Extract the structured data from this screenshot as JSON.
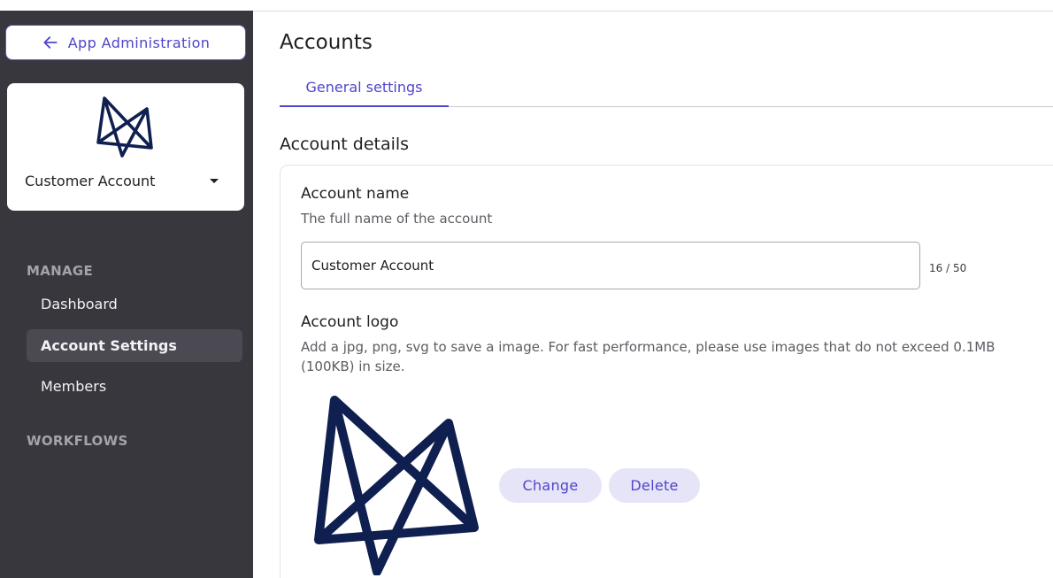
{
  "sidebar": {
    "back_label": "App Administration",
    "account": {
      "name": "Customer Account"
    },
    "sections": [
      {
        "label": "MANAGE",
        "items": [
          {
            "label": "Dashboard",
            "active": false
          },
          {
            "label": "Account Settings",
            "active": true
          },
          {
            "label": "Members",
            "active": false
          }
        ]
      },
      {
        "label": "WORKFLOWS",
        "items": []
      }
    ]
  },
  "main": {
    "title": "Accounts",
    "tabs": [
      {
        "label": "General settings",
        "active": true
      }
    ],
    "section_title": "Account details",
    "account_name": {
      "label": "Account name",
      "help": "The full name of the account",
      "value": "Customer Account",
      "counter": "16 / 50"
    },
    "account_logo": {
      "label": "Account logo",
      "help": "Add a jpg, png, svg to save a image. For fast performance, please use images that do not exceed 0.1MB (100KB) in size.",
      "change_label": "Change",
      "delete_label": "Delete"
    }
  },
  "colors": {
    "accent": "#4f46c9",
    "sidebar_bg": "#38373d",
    "logo": "#0f1f4f",
    "pill_bg": "#e6e4f7"
  },
  "icons": [
    "arrow-left-icon",
    "caret-down-icon",
    "account-logo"
  ]
}
